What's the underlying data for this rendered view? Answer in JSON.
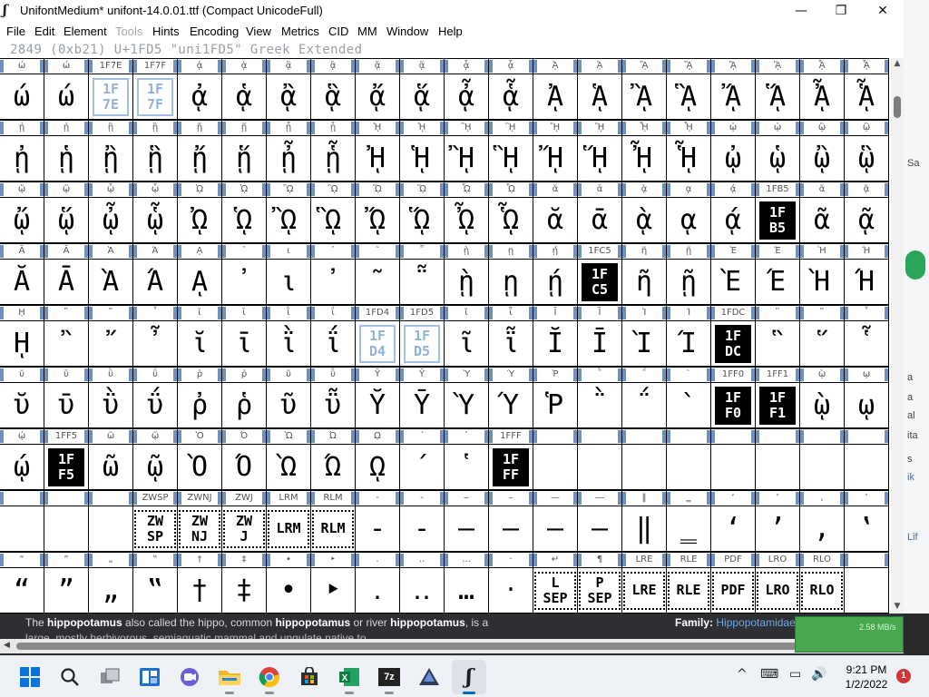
{
  "window": {
    "icon": "ʃ",
    "title": "UnifontMedium*  unifont-14.0.01.ttf (Compact UnicodeFull)",
    "minimize": "—",
    "maximize": "❐",
    "close": "✕"
  },
  "menu": [
    {
      "label": "File",
      "disabled": false
    },
    {
      "label": "Edit",
      "disabled": false
    },
    {
      "label": "Element",
      "disabled": false
    },
    {
      "label": "Tools",
      "disabled": true
    },
    {
      "label": "Hints",
      "disabled": false
    },
    {
      "label": "Encoding",
      "disabled": false
    },
    {
      "label": "View",
      "disabled": false
    },
    {
      "label": "Metrics",
      "disabled": false
    },
    {
      "label": "CID",
      "disabled": false
    },
    {
      "label": "MM",
      "disabled": false
    },
    {
      "label": "Window",
      "disabled": false
    },
    {
      "label": "Help",
      "disabled": false
    }
  ],
  "info_line": "2849 (0xb21) U+1FD5 \"uni1FD5\" Greek Extended",
  "grid_rows": [
    {
      "labels": [
        "ώ",
        "ώ",
        "1F7E",
        "1F7F",
        "ᾀ",
        "ᾁ",
        "ᾂ",
        "ᾃ",
        "ᾄ",
        "ᾅ",
        "ᾆ",
        "ᾇ",
        "ᾈ",
        "ᾉ",
        "ᾊ",
        "ᾋ",
        "ᾌ",
        "ᾍ",
        "ᾎ",
        "ᾏ"
      ],
      "glyphs": [
        {
          "t": "ώ"
        },
        {
          "t": "ώ"
        },
        {
          "t": "1F\n7E",
          "k": "blue"
        },
        {
          "t": "1F\n7F",
          "k": "blue"
        },
        {
          "t": "ᾀ"
        },
        {
          "t": "ᾁ"
        },
        {
          "t": "ᾂ"
        },
        {
          "t": "ᾃ"
        },
        {
          "t": "ᾄ"
        },
        {
          "t": "ᾅ"
        },
        {
          "t": "ᾆ"
        },
        {
          "t": "ᾇ"
        },
        {
          "t": "ᾈ"
        },
        {
          "t": "ᾉ"
        },
        {
          "t": "ᾊ"
        },
        {
          "t": "ᾋ"
        },
        {
          "t": "ᾌ"
        },
        {
          "t": "ᾍ"
        },
        {
          "t": "ᾎ"
        },
        {
          "t": "ᾏ"
        }
      ]
    },
    {
      "labels": [
        "ᾐ",
        "ᾑ",
        "ᾒ",
        "ᾓ",
        "ᾔ",
        "ᾕ",
        "ᾖ",
        "ᾗ",
        "ᾘ",
        "ᾙ",
        "ᾚ",
        "ᾛ",
        "ᾜ",
        "ᾝ",
        "ᾞ",
        "ᾟ",
        "ᾠ",
        "ᾡ",
        "ᾢ",
        "ᾣ"
      ],
      "glyphs": [
        {
          "t": "ᾐ"
        },
        {
          "t": "ᾑ"
        },
        {
          "t": "ᾒ"
        },
        {
          "t": "ᾓ"
        },
        {
          "t": "ᾔ"
        },
        {
          "t": "ᾕ"
        },
        {
          "t": "ᾖ"
        },
        {
          "t": "ᾗ"
        },
        {
          "t": "ᾘ"
        },
        {
          "t": "ᾙ"
        },
        {
          "t": "ᾚ"
        },
        {
          "t": "ᾛ"
        },
        {
          "t": "ᾜ"
        },
        {
          "t": "ᾝ"
        },
        {
          "t": "ᾞ"
        },
        {
          "t": "ᾟ"
        },
        {
          "t": "ᾠ"
        },
        {
          "t": "ᾡ"
        },
        {
          "t": "ᾢ"
        },
        {
          "t": "ᾣ"
        }
      ]
    },
    {
      "labels": [
        "ᾤ",
        "ᾥ",
        "ᾦ",
        "ᾧ",
        "ᾨ",
        "ᾩ",
        "ᾪ",
        "ᾫ",
        "ᾬ",
        "ᾭ",
        "ᾮ",
        "ᾯ",
        "ᾰ",
        "ᾱ",
        "ᾲ",
        "ᾳ",
        "ᾴ",
        "1FB5",
        "ᾶ",
        "ᾷ"
      ],
      "glyphs": [
        {
          "t": "ᾤ"
        },
        {
          "t": "ᾥ"
        },
        {
          "t": "ᾦ"
        },
        {
          "t": "ᾧ"
        },
        {
          "t": "ᾨ"
        },
        {
          "t": "ᾩ"
        },
        {
          "t": "ᾪ"
        },
        {
          "t": "ᾫ"
        },
        {
          "t": "ᾬ"
        },
        {
          "t": "ᾭ"
        },
        {
          "t": "ᾮ"
        },
        {
          "t": "ᾯ"
        },
        {
          "t": "ᾰ"
        },
        {
          "t": "ᾱ"
        },
        {
          "t": "ᾲ"
        },
        {
          "t": "ᾳ"
        },
        {
          "t": "ᾴ"
        },
        {
          "t": "1F\nB5",
          "k": "inv"
        },
        {
          "t": "ᾶ"
        },
        {
          "t": "ᾷ"
        }
      ]
    },
    {
      "labels": [
        "Ᾰ",
        "Ᾱ",
        "Ὰ",
        "Ά",
        "ᾼ",
        "᾽",
        "ι",
        "᾿",
        "῀",
        "῁",
        "ῂ",
        "ῃ",
        "ῄ",
        "1FC5",
        "ῆ",
        "ῇ",
        "Ὲ",
        "Έ",
        "Ὴ",
        "Ή"
      ],
      "glyphs": [
        {
          "t": "Ᾰ"
        },
        {
          "t": "Ᾱ"
        },
        {
          "t": "Ὰ"
        },
        {
          "t": "Ά"
        },
        {
          "t": "ᾼ"
        },
        {
          "t": "᾽"
        },
        {
          "t": "ι"
        },
        {
          "t": "᾿"
        },
        {
          "t": "῀"
        },
        {
          "t": "῁"
        },
        {
          "t": "ῂ"
        },
        {
          "t": "ῃ"
        },
        {
          "t": "ῄ"
        },
        {
          "t": "1F\nC5",
          "k": "inv"
        },
        {
          "t": "ῆ"
        },
        {
          "t": "ῇ"
        },
        {
          "t": "Ὲ"
        },
        {
          "t": "Έ"
        },
        {
          "t": "Ὴ"
        },
        {
          "t": "Ή"
        }
      ]
    },
    {
      "labels": [
        "ῌ",
        "῍",
        "῎",
        "῏",
        "ῐ",
        "ῑ",
        "ῒ",
        "ΐ",
        "1FD4",
        "1FD5",
        "ῖ",
        "ῗ",
        "Ῐ",
        "Ῑ",
        "Ὶ",
        "Ί",
        "1FDC",
        "῝",
        "῞",
        "῟"
      ],
      "glyphs": [
        {
          "t": "ῌ"
        },
        {
          "t": "῍"
        },
        {
          "t": "῎"
        },
        {
          "t": "῏"
        },
        {
          "t": "ῐ"
        },
        {
          "t": "ῑ"
        },
        {
          "t": "ῒ"
        },
        {
          "t": "ΐ"
        },
        {
          "t": "1F\nD4",
          "k": "blue"
        },
        {
          "t": "1F\nD5",
          "k": "blue"
        },
        {
          "t": "ῖ"
        },
        {
          "t": "ῗ"
        },
        {
          "t": "Ῐ"
        },
        {
          "t": "Ῑ"
        },
        {
          "t": "Ὶ"
        },
        {
          "t": "Ί"
        },
        {
          "t": "1F\nDC",
          "k": "inv"
        },
        {
          "t": "῝"
        },
        {
          "t": "῞"
        },
        {
          "t": "῟"
        }
      ]
    },
    {
      "labels": [
        "ῠ",
        "ῡ",
        "ῢ",
        "ΰ",
        "ῤ",
        "ῥ",
        "ῦ",
        "ῧ",
        "Ῠ",
        "Ῡ",
        "Ὺ",
        "Ύ",
        "Ῥ",
        "῭",
        "΅",
        "`",
        "1FF0",
        "1FF1",
        "ῲ",
        "ῳ"
      ],
      "glyphs": [
        {
          "t": "ῠ"
        },
        {
          "t": "ῡ"
        },
        {
          "t": "ῢ"
        },
        {
          "t": "ΰ"
        },
        {
          "t": "ῤ"
        },
        {
          "t": "ῥ"
        },
        {
          "t": "ῦ"
        },
        {
          "t": "ῧ"
        },
        {
          "t": "Ῠ"
        },
        {
          "t": "Ῡ"
        },
        {
          "t": "Ὺ"
        },
        {
          "t": "Ύ"
        },
        {
          "t": "Ῥ"
        },
        {
          "t": "῭"
        },
        {
          "t": "΅"
        },
        {
          "t": "`"
        },
        {
          "t": "1F\nF0",
          "k": "inv"
        },
        {
          "t": "1F\nF1",
          "k": "inv"
        },
        {
          "t": "ῲ"
        },
        {
          "t": "ῳ"
        }
      ]
    },
    {
      "labels": [
        "ῴ",
        "1FF5",
        "ῶ",
        "ῷ",
        "Ὸ",
        "Ό",
        "Ὼ",
        "Ώ",
        "ῼ",
        "´",
        "῾",
        "1FFF",
        "",
        "",
        "",
        "",
        "",
        "",
        "",
        ""
      ],
      "glyphs": [
        {
          "t": "ῴ"
        },
        {
          "t": "1F\nF5",
          "k": "inv"
        },
        {
          "t": "ῶ"
        },
        {
          "t": "ῷ"
        },
        {
          "t": "Ὸ"
        },
        {
          "t": "Ό"
        },
        {
          "t": "Ὼ"
        },
        {
          "t": "Ώ"
        },
        {
          "t": "ῼ"
        },
        {
          "t": "´"
        },
        {
          "t": "῾"
        },
        {
          "t": "1F\nFF",
          "k": "inv"
        },
        {
          "t": ""
        },
        {
          "t": ""
        },
        {
          "t": ""
        },
        {
          "t": ""
        },
        {
          "t": ""
        },
        {
          "t": ""
        },
        {
          "t": ""
        },
        {
          "t": ""
        }
      ]
    },
    {
      "labels": [
        "",
        "",
        "",
        "ZWSP",
        "ZWNJ",
        "ZWJ",
        "LRM",
        "RLM",
        "‐",
        "‑",
        "‒",
        "–",
        "—",
        "―",
        "‖",
        "‗",
        "‘",
        "’",
        "‚",
        "‛"
      ],
      "glyphs": [
        {
          "t": ""
        },
        {
          "t": ""
        },
        {
          "t": ""
        },
        {
          "t": "ZW\nSP",
          "k": "dots"
        },
        {
          "t": "ZW\nNJ",
          "k": "dots"
        },
        {
          "t": "ZW\nJ",
          "k": "dots"
        },
        {
          "t": "LRM",
          "k": "dots"
        },
        {
          "t": "RLM",
          "k": "dots"
        },
        {
          "t": "‐"
        },
        {
          "t": "‑"
        },
        {
          "t": "‒"
        },
        {
          "t": "–"
        },
        {
          "t": "—"
        },
        {
          "t": "―"
        },
        {
          "t": "‖"
        },
        {
          "t": "‗"
        },
        {
          "t": "‘"
        },
        {
          "t": "’"
        },
        {
          "t": "‚"
        },
        {
          "t": "‛"
        }
      ]
    },
    {
      "labels": [
        "“",
        "”",
        "„",
        "‟",
        "†",
        "‡",
        "•",
        "‣",
        "․",
        "‥",
        "…",
        "‧",
        "↵",
        "¶",
        "LRE",
        "RLE",
        "PDF",
        "LRO",
        "RLO",
        " "
      ],
      "glyphs": [
        {
          "t": "“"
        },
        {
          "t": "”"
        },
        {
          "t": "„"
        },
        {
          "t": "‟"
        },
        {
          "t": "†"
        },
        {
          "t": "‡"
        },
        {
          "t": "•"
        },
        {
          "t": "‣"
        },
        {
          "t": "․"
        },
        {
          "t": "‥"
        },
        {
          "t": "…"
        },
        {
          "t": "‧"
        },
        {
          "t": "L\nSEP",
          "k": "dots"
        },
        {
          "t": "P\nSEP",
          "k": "dots"
        },
        {
          "t": "LRE",
          "k": "dots"
        },
        {
          "t": "RLE",
          "k": "dots"
        },
        {
          "t": "PDF",
          "k": "dots"
        },
        {
          "t": "LRO",
          "k": "dots"
        },
        {
          "t": "RLO",
          "k": "dots"
        },
        {
          "t": ""
        }
      ]
    }
  ],
  "background_page": {
    "paragraph_parts": [
      "The ",
      "hippopotamus",
      " also called the hippo, common ",
      "hippopotamus",
      " or river ",
      "hippopotamus",
      ", is a"
    ],
    "paragraph_line2": "large, mostly herbivorous, semiaquatic mammal and ungulate native to",
    "family_label": "Family:",
    "family_value": "Hippopotamidae",
    "net_speed": "2.58 MB/s",
    "side_snippets": [
      "Sa",
      "a",
      "a",
      "al",
      "ita",
      "s",
      "ik",
      "Lif"
    ]
  },
  "taskbar": {
    "time": "9:21 PM",
    "date": "1/2/2022",
    "notifications": "1",
    "apps": [
      "start-icon",
      "search-icon",
      "task-view-icon",
      "widgets-icon",
      "teams-chat-icon",
      "file-explorer-icon",
      "chrome-icon",
      "store-icon",
      "excel-icon",
      "7zip-icon",
      "inkscape-icon",
      "fontforge-icon"
    ],
    "seven_zip": "7z",
    "tray": [
      "^",
      "⌨",
      "▭",
      "🔊"
    ]
  }
}
